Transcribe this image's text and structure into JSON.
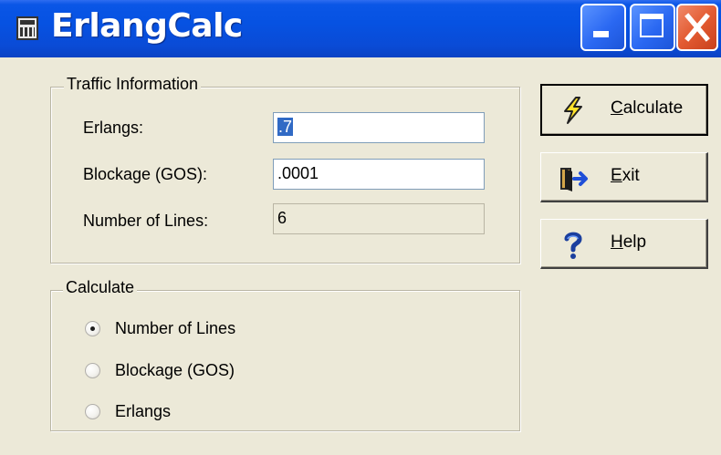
{
  "window": {
    "title": "ErlangCalc"
  },
  "traffic": {
    "legend": "Traffic Information",
    "erlangs_label": "Erlangs:",
    "erlangs_value": ".7",
    "gos_label": "Blockage (GOS):",
    "gos_value": ".0001",
    "lines_label": "Number of Lines:",
    "lines_value": "6"
  },
  "calculate": {
    "legend": "Calculate",
    "options": [
      {
        "label": "Number of Lines",
        "checked": true
      },
      {
        "label": "Blockage (GOS)",
        "checked": false
      },
      {
        "label": "Erlangs",
        "checked": false
      }
    ]
  },
  "buttons": {
    "calculate_first": "C",
    "calculate_rest": "alculate",
    "exit_first": "E",
    "exit_rest": "xit",
    "help_first": "H",
    "help_rest": "elp"
  },
  "icons": {
    "app": "calculator-icon",
    "calculate": "lightning-icon",
    "exit": "exit-door-icon",
    "help": "question-mark-icon"
  }
}
